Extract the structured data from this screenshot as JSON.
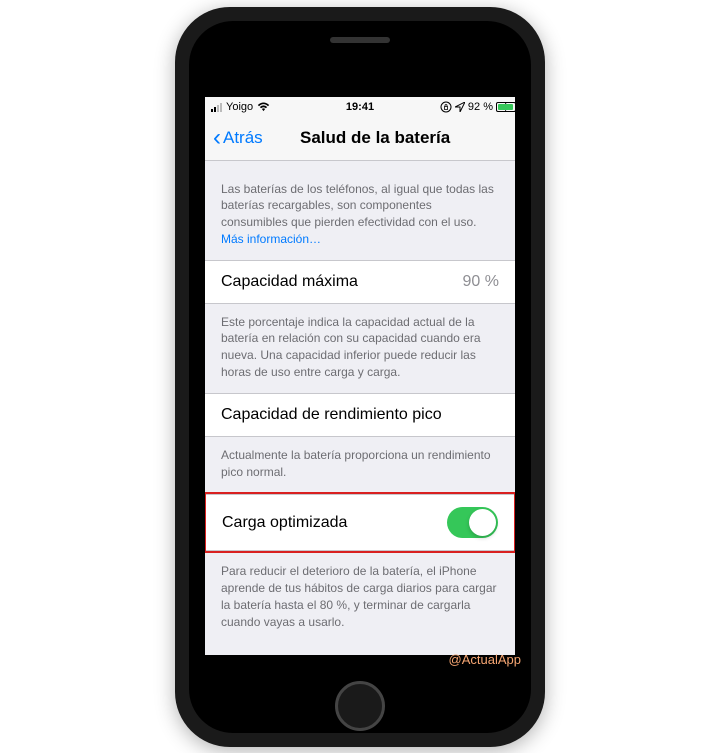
{
  "status": {
    "carrier": "Yoigo",
    "time": "19:41",
    "battery_percent": "92 %"
  },
  "nav": {
    "back_label": "Atrás",
    "title": "Salud de la batería"
  },
  "section1": {
    "footer": "Las baterías de los teléfonos, al igual que todas las baterías recargables, son componentes consumibles que pierden efectividad con el uso. ",
    "link": "Más información…"
  },
  "maxCapacity": {
    "label": "Capacidad máxima",
    "value": "90 %",
    "footer": "Este porcentaje indica la capacidad actual de la batería en relación con su capacidad cuando era nueva. Una capacidad inferior puede reducir las horas de uso entre carga y carga."
  },
  "peakPerformance": {
    "label": "Capacidad de rendimiento pico",
    "footer": "Actualmente la batería proporciona un rendimiento pico normal."
  },
  "optimizedCharging": {
    "label": "Carga optimizada",
    "footer": "Para reducir el deterioro de la batería, el iPhone aprende de tus hábitos de carga diarios para cargar la batería hasta el 80 %, y terminar de cargarla cuando vayas a usarlo."
  },
  "watermark": "@ActualApp"
}
